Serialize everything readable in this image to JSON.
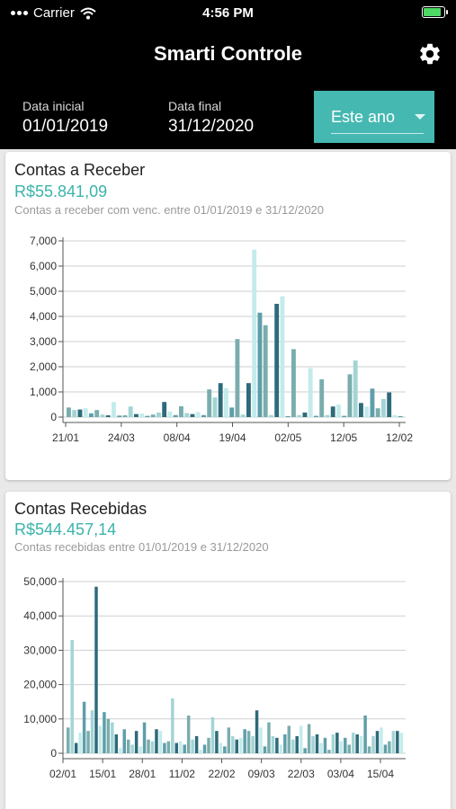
{
  "status_bar": {
    "carrier": "Carrier",
    "time": "4:56 PM"
  },
  "header": {
    "title": "Smarti Controle",
    "start_label": "Data inicial",
    "start_value": "01/01/2019",
    "end_label": "Data final",
    "end_value": "31/12/2020",
    "period_selected": "Este ano"
  },
  "colors": {
    "accent": "#45b8b1",
    "amount": "#3bb3ab",
    "bar_palette": [
      "#7aadad",
      "#a3d4d4",
      "#2e6a7a",
      "#c3ebeb",
      "#5f9eaa"
    ]
  },
  "cards": [
    {
      "title": "Contas a Receber",
      "amount": "R$55.841,09",
      "subtitle": "Contas a receber com venc. entre 01/01/2019 e 31/12/2020"
    },
    {
      "title": "Contas Recebidas",
      "amount": "R$544.457,14",
      "subtitle": "Contas recebidas entre 01/01/2019 e 31/12/2020"
    }
  ],
  "chart_data": [
    {
      "type": "bar",
      "ylim": [
        0,
        7000
      ],
      "yticks": [
        0,
        1000,
        2000,
        3000,
        4000,
        5000,
        6000,
        7000
      ],
      "ytick_labels": [
        "0",
        "1,000",
        "2,000",
        "3,000",
        "4,000",
        "5,000",
        "6,000",
        "7,000"
      ],
      "xtick_labels": [
        "21/01",
        "24/03",
        "08/04",
        "19/04",
        "02/05",
        "12/05",
        "12/02"
      ],
      "grid": true,
      "values": [
        380,
        280,
        300,
        350,
        150,
        280,
        100,
        70,
        600,
        60,
        70,
        420,
        120,
        140,
        50,
        100,
        180,
        600,
        220,
        80,
        430,
        160,
        120,
        200,
        80,
        1100,
        780,
        1350,
        1150,
        380,
        3100,
        100,
        1350,
        6650,
        4150,
        3650,
        80,
        4500,
        4800,
        40,
        2700,
        80,
        180,
        1950,
        50,
        1500,
        80,
        420,
        500,
        50,
        1700,
        2250,
        560,
        420,
        1130,
        350,
        720,
        980,
        80,
        40
      ]
    },
    {
      "type": "bar",
      "ylim": [
        0,
        50000
      ],
      "yticks": [
        0,
        10000,
        20000,
        30000,
        40000,
        50000
      ],
      "ytick_labels": [
        "0",
        "10,000",
        "20,000",
        "30,000",
        "40,000",
        "50,000"
      ],
      "xtick_labels": [
        "02/01",
        "15/01",
        "28/01",
        "11/02",
        "22/02",
        "09/03",
        "22/03",
        "03/04",
        "15/04"
      ],
      "grid": true,
      "values": [
        7500,
        33000,
        3000,
        6000,
        15000,
        6500,
        12500,
        48500,
        8000,
        12000,
        10000,
        9000,
        5500,
        1500,
        7000,
        4000,
        2500,
        6500,
        2000,
        9000,
        4000,
        3500,
        7000,
        6500,
        3000,
        3500,
        16000,
        3000,
        3500,
        2500,
        11000,
        4000,
        5000,
        1000,
        2500,
        4500,
        10500,
        6500,
        3000,
        2000,
        7500,
        5000,
        4000,
        4500,
        7000,
        6500,
        5000,
        12500,
        7500,
        2000,
        9000,
        5000,
        4500,
        2500,
        5500,
        8000,
        4000,
        5000,
        8000,
        1500,
        8500,
        5000,
        5500,
        3000,
        4500,
        1000,
        5500,
        6000,
        3500,
        4500,
        2500,
        6000,
        5500,
        5000,
        11000,
        2000,
        5000,
        6500,
        7500,
        2500,
        3500,
        6500,
        6500,
        6000
      ]
    }
  ]
}
